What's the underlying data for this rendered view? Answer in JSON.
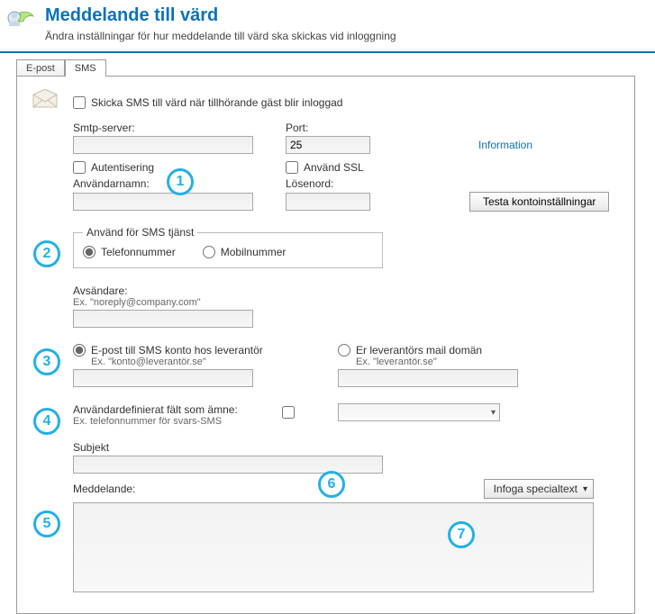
{
  "header": {
    "title": "Meddelande till värd",
    "subtitle": "Ändra inställningar för hur meddelande till värd ska skickas vid inloggning"
  },
  "tabs": {
    "email": "E-post",
    "sms": "SMS"
  },
  "main": {
    "send_sms_label": "Skicka SMS till värd när tillhörande gäst blir inloggad",
    "smtp_label": "Smtp-server:",
    "smtp_value": "",
    "port_label": "Port:",
    "port_value": "25",
    "info_link": "Information",
    "auth_label": "Autentisering",
    "ssl_label": "Använd SSL",
    "user_label": "Användarnamn:",
    "user_value": "",
    "pass_label": "Lösenord:",
    "pass_value": "",
    "test_button": "Testa kontoinställningar",
    "sms_service_legend": "Använd för SMS tjänst",
    "phone_radio": "Telefonnummer",
    "mobile_radio": "Mobilnummer",
    "sender_label": "Avsändare:",
    "sender_hint": "Ex. \"noreply@company.com\"",
    "sender_value": "",
    "acct_radio": "E-post till SMS konto hos leverantör",
    "acct_hint": "Ex. \"konto@leverantör.se\"",
    "acct_value": "",
    "domain_radio": "Er leverantörs mail domän",
    "domain_hint": "Ex. \"leverantör.se\"",
    "domain_value": "",
    "udf_label": "Användardefinierat fält som ämne:",
    "udf_hint": "Ex. telefonnummer för svars-SMS",
    "subject_label": "Subjekt",
    "subject_value": "",
    "message_label": "Meddelande:",
    "message_value": "",
    "insert_button": "Infoga specialtext"
  },
  "annotations": {
    "a1": "1",
    "a2": "2",
    "a3": "3",
    "a4": "4",
    "a5": "5",
    "a6": "6",
    "a7": "7"
  }
}
